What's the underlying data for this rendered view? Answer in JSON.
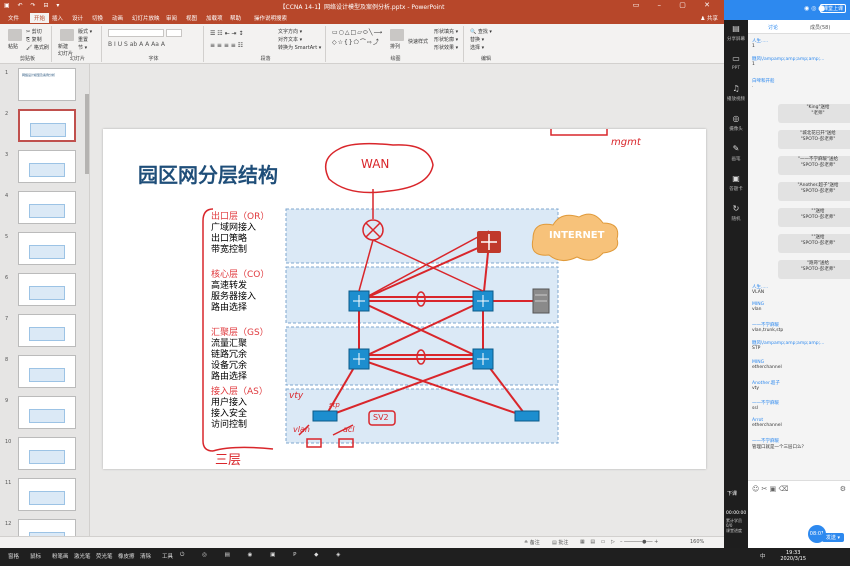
{
  "titlebar": {
    "title": "【CCNA 14-1】网络设计模型及案例分析.pptx - PowerPoint",
    "quick_access": "▣ ↶ ↷ ⊟ ▾",
    "window_controls": "▭ – ▢ ✕"
  },
  "tabs": [
    "文件",
    "开始",
    "插入",
    "设计",
    "切换",
    "动画",
    "幻灯片放映",
    "审阅",
    "视图",
    "加载项",
    "帮助",
    "操作说明搜索"
  ],
  "share_label": "♟ 共享",
  "ribbon": {
    "clipboard": {
      "name": "剪贴板",
      "paste": "粘贴",
      "cut": "✂ 剪切",
      "copy": "⎘ 复制",
      "format_painter": "🖌 格式刷"
    },
    "slides": {
      "name": "幻灯片",
      "new_slide": "新建\n幻灯片",
      "layout": "版式 ▾",
      "reset": "重置",
      "section": "节 ▾"
    },
    "font": {
      "name": "字体"
    },
    "paragraph": {
      "name": "段落",
      "text_direction": "文字方向 ▾",
      "align_text": "对齐文本 ▾",
      "smartart": "转换为 SmartArt ▾"
    },
    "drawing": {
      "name": "绘图",
      "arrange": "排列",
      "quick_styles": "快速样式",
      "fill": "形状填充 ▾",
      "outline": "形状轮廓 ▾",
      "effects": "形状效果 ▾"
    },
    "editing": {
      "name": "编辑",
      "find": "🔍 查找 ▾",
      "replace": "替换 ▾",
      "select": "选择 ▾"
    }
  },
  "thumbnails": [
    "1",
    "2",
    "3",
    "4",
    "5",
    "6",
    "7",
    "8",
    "9",
    "10",
    "11",
    "12"
  ],
  "thumbnail_title": "网络设计模型及案例分析",
  "slide": {
    "title": "园区网分层结构",
    "layers": [
      {
        "name": "出口层（OR）",
        "lines": [
          "广域网接入",
          "出口策略",
          "带宽控制"
        ]
      },
      {
        "name": "核心层（CO）",
        "lines": [
          "高速转发",
          "服务器接入",
          "路由选择"
        ]
      },
      {
        "name": "汇聚层（GS）",
        "lines": [
          "流量汇聚",
          "链路冗余",
          "设备冗余",
          "路由选择"
        ]
      },
      {
        "name": "接入层（AS）",
        "lines": [
          "用户接入",
          "接入安全",
          "访问控制"
        ]
      }
    ],
    "internet": "INTERNET",
    "annotations": {
      "wan": "WAN",
      "mgmt": "mgmt",
      "san_ceng": "三层",
      "vty": "vty",
      "vlan": "vlan",
      "acl": "acl",
      "stp": "stp",
      "sv2": "SV2"
    }
  },
  "status": {
    "notes": "≙ 备注",
    "comments": "▤ 批注",
    "zoom": "160%"
  },
  "panel": {
    "live_badge": "课堂上课",
    "tab_discuss": "讨论",
    "tab_members": "成员(58)",
    "side_icons": [
      {
        "icon": "▤",
        "label": "分享屏幕"
      },
      {
        "icon": "▭",
        "label": "PPT"
      },
      {
        "icon": "♫",
        "label": "播放视频"
      },
      {
        "icon": "◎",
        "label": "摄像头"
      },
      {
        "icon": "✎",
        "label": "画笔"
      },
      {
        "icon": "▣",
        "label": "答题卡"
      },
      {
        "icon": "↻",
        "label": "随机"
      }
    ],
    "messages": [
      {
        "name": "人生.....",
        "text": "1"
      },
      {
        "name": "糖风\\/ampamp;amp;amp;amp;...",
        "text": "1"
      },
      {
        "name": "白啤和开船",
        "text": "."
      },
      {
        "name": "人生.....",
        "text": "VLAN"
      },
      {
        "name": "MING",
        "text": "vlan"
      },
      {
        "name": "一一不学麻暖",
        "text": "vlan,trunk,stp"
      },
      {
        "name": "糖风\\/ampamp;amp;amp;amp;...",
        "text": "STP"
      },
      {
        "name": "MING",
        "text": "etherchannel"
      },
      {
        "name": "Another.超子",
        "text": "vty"
      },
      {
        "name": "一一不学麻暖",
        "text": "ssl"
      },
      {
        "name": "Arrot",
        "text": "etherchannel"
      },
      {
        "name": "一一不学麻暖",
        "text": "管理口就是一个三层口么？"
      }
    ],
    "gifts": [
      {
        "from": "\"King\"送给",
        "to": "\"老师\""
      },
      {
        "from": "\"城北花已开\"送给",
        "to": "\"SPOTO-彭老师\""
      },
      {
        "from": "\"一一不学麻暖\"送给",
        "to": "\"SPOTO-彭老师\""
      },
      {
        "from": "\"Another.超子\"送给",
        "to": "\"SPOTO-彭老师\""
      },
      {
        "from": "\"\"送给",
        "to": "\"SPOTO-彭老师\""
      },
      {
        "from": "\"\"送给",
        "to": "\"SPOTO-彭老师\""
      },
      {
        "from": "\"跑哥\"送给",
        "to": "\"SPOTO-彭老师\""
      }
    ],
    "timer": "00:00:00",
    "stats": "累计学员\n0/0\n课堂进度",
    "send": "发送 ▾",
    "end_btn": "下课"
  },
  "taskbar": {
    "items": [
      "窗格",
      "鼠标",
      "粉笔画",
      "激光笔",
      "荧光笔",
      "橡皮擦",
      "清除",
      "工具"
    ],
    "time": "19:33",
    "date": "2020/3/15",
    "lang": "中"
  }
}
